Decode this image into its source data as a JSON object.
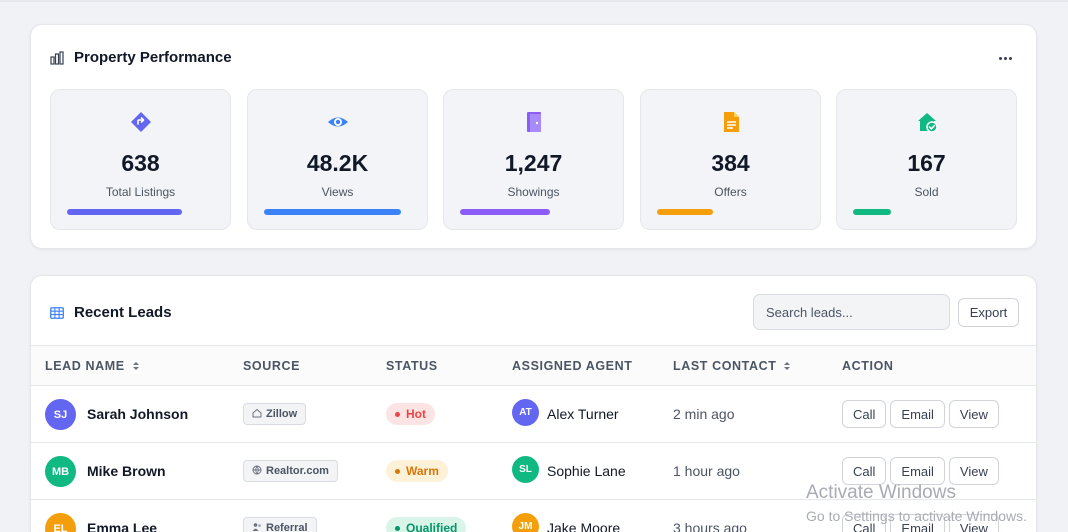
{
  "performance": {
    "title": "Property Performance",
    "more_icon": "more-horizontal-icon",
    "stats": [
      {
        "value": "638",
        "label": "Total Listings",
        "icon": "tag-arrow-icon",
        "color": "#6366f1",
        "progress": 0.78
      },
      {
        "value": "48.2K",
        "label": "Views",
        "icon": "eye-icon",
        "color": "#3b82f6",
        "progress": 0.93
      },
      {
        "value": "1,247",
        "label": "Showings",
        "icon": "door-icon",
        "color": "#8b5cf6",
        "progress": 0.61
      },
      {
        "value": "384",
        "label": "Offers",
        "icon": "document-icon",
        "color": "#f59e0b",
        "progress": 0.38
      },
      {
        "value": "167",
        "label": "Sold",
        "icon": "house-check-icon",
        "color": "#10b981",
        "progress": 0.26
      }
    ]
  },
  "leads": {
    "title": "Recent Leads",
    "search_placeholder": "Search leads...",
    "export_label": "Export",
    "columns": [
      "LEAD NAME",
      "SOURCE",
      "STATUS",
      "ASSIGNED AGENT",
      "LAST CONTACT",
      "ACTION"
    ],
    "rows": [
      {
        "initials": "SJ",
        "name": "Sarah Johnson",
        "avatar_color": "#6366f1",
        "source": "Zillow",
        "source_icon": "home-icon",
        "status": "Hot",
        "status_color": "#ef4444",
        "status_bg": "#fde4e4",
        "agent_initials": "AT",
        "agent": "Alex Turner",
        "agent_color": "#6366f1",
        "last_contact": "2 min ago",
        "actions": [
          "Call",
          "Email",
          "View"
        ]
      },
      {
        "initials": "MB",
        "name": "Mike Brown",
        "avatar_color": "#10b981",
        "source": "Realtor.com",
        "source_icon": "globe-icon",
        "status": "Warm",
        "status_color": "#d97706",
        "status_bg": "#fdf1d8",
        "agent_initials": "SL",
        "agent": "Sophie Lane",
        "agent_color": "#10b981",
        "last_contact": "1 hour ago",
        "actions": [
          "Call",
          "Email",
          "View"
        ]
      },
      {
        "initials": "EL",
        "name": "Emma Lee",
        "avatar_color": "#f59e0b",
        "source": "Referral",
        "source_icon": "users-icon",
        "status": "Qualified",
        "status_color": "#059669",
        "status_bg": "#d8f5e8",
        "agent_initials": "JM",
        "agent": "Jake Moore",
        "agent_color": "#f59e0b",
        "last_contact": "3 hours ago",
        "actions": [
          "Call",
          "Email",
          "View"
        ]
      }
    ]
  },
  "watermark": {
    "line1": "Activate Windows",
    "line2": "Go to Settings to activate Windows."
  }
}
